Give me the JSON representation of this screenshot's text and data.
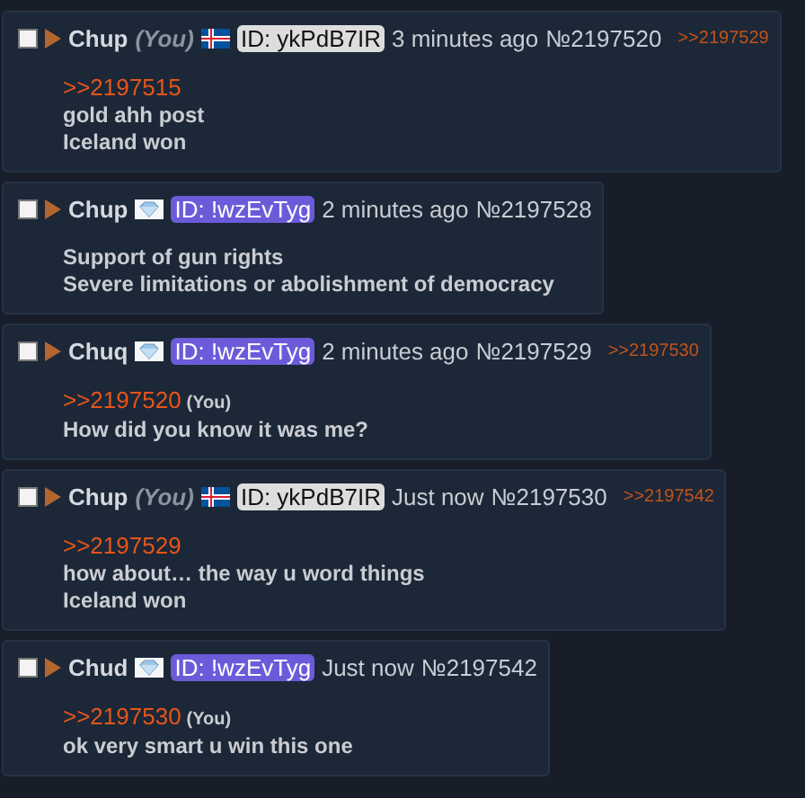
{
  "posts": [
    {
      "checked": false,
      "name": "Chup",
      "you": "(You)",
      "flag": {
        "kind": "iceland"
      },
      "id": {
        "text": "ID: ykPdB7IR",
        "color": "#dddddd"
      },
      "time": "3 minutes ago",
      "number": "№2197520",
      "backlinks": [
        ">>2197529"
      ],
      "lines": [
        {
          "kind": "quote",
          "text": ">>2197515"
        },
        {
          "kind": "text",
          "text": "gold ahh post"
        },
        {
          "kind": "text",
          "text": "Iceland won"
        }
      ]
    },
    {
      "checked": false,
      "name": "Chup",
      "flag": {
        "kind": "gem"
      },
      "id": {
        "text": "ID: !wzEvTyg",
        "color": "#6c5bd9"
      },
      "time": "2 minutes ago",
      "number": "№2197528",
      "lines": [
        {
          "kind": "text",
          "text": "Support of gun rights"
        },
        {
          "kind": "text",
          "text": "Severe limitations or abolishment of democracy"
        }
      ]
    },
    {
      "checked": false,
      "name": "Chuq",
      "flag": {
        "kind": "gem"
      },
      "id": {
        "text": "ID: !wzEvTyg",
        "color": "#6c5bd9"
      },
      "time": "2 minutes ago",
      "number": "№2197529",
      "backlinks": [
        ">>2197530"
      ],
      "lines": [
        {
          "kind": "quote",
          "text": ">>2197520",
          "you": "(You)"
        },
        {
          "kind": "text",
          "text": "How did you know it was me?"
        }
      ]
    },
    {
      "checked": false,
      "name": "Chup",
      "you": "(You)",
      "flag": {
        "kind": "iceland"
      },
      "id": {
        "text": "ID: ykPdB7IR",
        "color": "#dddddd"
      },
      "time": "Just now",
      "number": "№2197530",
      "backlinks": [
        ">>2197542"
      ],
      "lines": [
        {
          "kind": "quote",
          "text": ">>2197529"
        },
        {
          "kind": "text",
          "text": "how about… the way u word things"
        },
        {
          "kind": "text",
          "text": "Iceland won"
        }
      ]
    },
    {
      "checked": false,
      "name": "Chud",
      "flag": {
        "kind": "gem"
      },
      "id": {
        "text": "ID: !wzEvTyg",
        "color": "#6c5bd9"
      },
      "time": "Just now",
      "number": "№2197542",
      "lines": [
        {
          "kind": "quote",
          "text": ">>2197530",
          "you": "(You)"
        },
        {
          "kind": "text",
          "text": "ok very smart u win this one"
        }
      ]
    }
  ]
}
